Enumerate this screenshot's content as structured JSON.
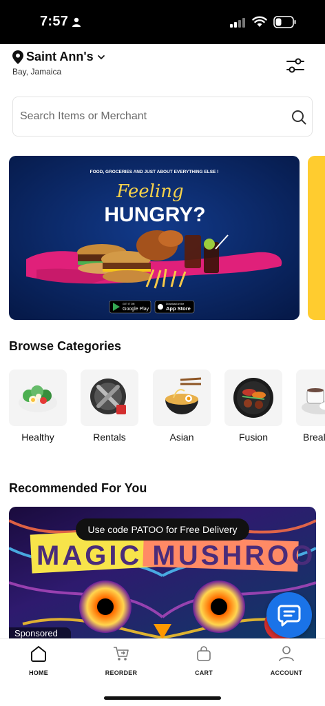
{
  "status_bar": {
    "time": "7:57"
  },
  "location": {
    "title": "Saint Ann's",
    "subtitle": "Bay, Jamaica"
  },
  "search": {
    "placeholder": "Search Items or Merchant"
  },
  "banner": {
    "tagline": "FOOD, GROCERIES AND JUST ABOUT EVERYTHING ELSE !",
    "headline_script": "Feeling",
    "headline": "HUNGRY?",
    "google_play_small": "GET IT ON",
    "google_play": "Google Play",
    "app_store_small": "Download on the",
    "app_store": "App Store"
  },
  "categories": {
    "title": "Browse Categories",
    "items": [
      {
        "label": "Healthy",
        "icon": "salad-icon"
      },
      {
        "label": "Rentals",
        "icon": "tools-icon"
      },
      {
        "label": "Asian",
        "icon": "ramen-icon"
      },
      {
        "label": "Fusion",
        "icon": "fusion-plate-icon"
      },
      {
        "label": "Breal",
        "icon": "breakfast-icon"
      }
    ]
  },
  "recommended": {
    "title": "Recommended For You",
    "card_text": "MAGIC MUSHROOMS",
    "promo": "Use code PATOO for Free Delivery",
    "sponsored": "Sponsored"
  },
  "nav": {
    "items": [
      {
        "label": "HOME",
        "icon": "home-icon"
      },
      {
        "label": "REORDER",
        "icon": "reorder-cart-icon"
      },
      {
        "label": "CART",
        "icon": "bag-icon"
      },
      {
        "label": "ACCOUNT",
        "icon": "user-icon"
      }
    ]
  },
  "colors": {
    "accent": "#1a73e8",
    "banner_bg": "#0b2a6b",
    "brush": "#e0207a"
  }
}
